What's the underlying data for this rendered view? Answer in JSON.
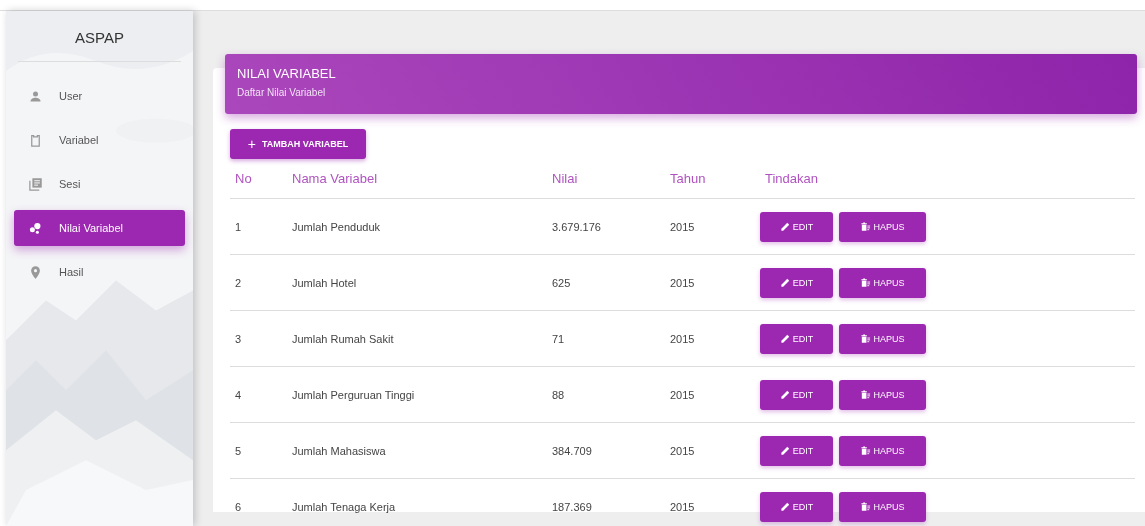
{
  "sidebar": {
    "brand": "ASPAP",
    "items": [
      {
        "label": "User",
        "selected": false
      },
      {
        "label": "Variabel",
        "selected": false
      },
      {
        "label": "Sesi",
        "selected": false
      },
      {
        "label": "Nilai Variabel",
        "selected": true
      },
      {
        "label": "Hasil",
        "selected": false
      }
    ]
  },
  "card": {
    "title": "NILAI VARIABEL",
    "subtitle": "Daftar Nilai Variabel",
    "add_button": {
      "icon": "+",
      "label": "TAMBAH VARIABEL"
    },
    "table": {
      "columns": [
        "No",
        "Nama Variabel",
        "Nilai",
        "Tahun",
        "Tindakan"
      ],
      "rows": [
        {
          "no": "1",
          "name": "Jumlah Penduduk",
          "value": "3.679.176",
          "year": "2015",
          "edit": "EDIT",
          "delete": "HAPUS"
        },
        {
          "no": "2",
          "name": "Jumlah Hotel",
          "value": "625",
          "year": "2015",
          "edit": "EDIT",
          "delete": "HAPUS"
        },
        {
          "no": "3",
          "name": "Jumlah Rumah Sakit",
          "value": "71",
          "year": "2015",
          "edit": "EDIT",
          "delete": "HAPUS"
        },
        {
          "no": "4",
          "name": "Jumlah Perguruan Tinggi",
          "value": "88",
          "year": "2015",
          "edit": "EDIT",
          "delete": "HAPUS"
        },
        {
          "no": "5",
          "name": "Jumlah Mahasiswa",
          "value": "384.709",
          "year": "2015",
          "edit": "EDIT",
          "delete": "HAPUS"
        },
        {
          "no": "6",
          "name": "Jumlah Tenaga Kerja",
          "value": "187.369",
          "year": "2015",
          "edit": "EDIT",
          "delete": "HAPUS"
        }
      ]
    }
  }
}
